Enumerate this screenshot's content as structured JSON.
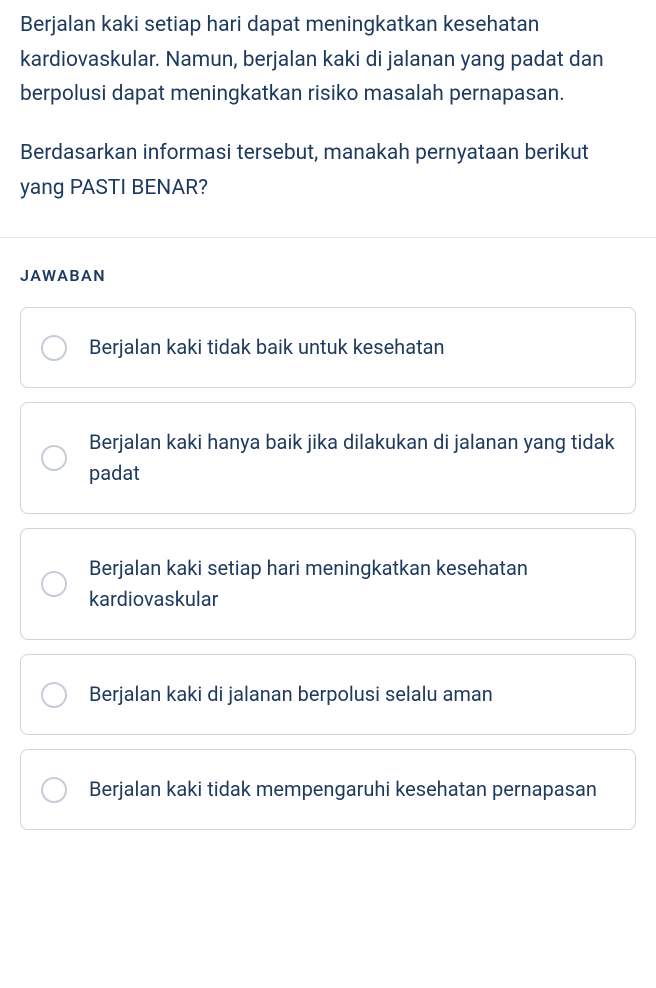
{
  "question": {
    "paragraph1": "Berjalan kaki setiap hari dapat meningkatkan kesehatan kardiovaskular. Namun, berjalan kaki di jalanan yang padat dan berpolusi dapat meningkatkan risiko masalah pernapasan.",
    "paragraph2": "Berdasarkan informasi tersebut, manakah pernyataan berikut yang PASTI BENAR?"
  },
  "answerHeading": "JAWABAN",
  "answers": [
    {
      "label": "Berjalan kaki tidak baik untuk kesehatan"
    },
    {
      "label": "Berjalan kaki hanya baik jika dilakukan di jalanan yang tidak padat"
    },
    {
      "label": "Berjalan kaki setiap hari meningkatkan kesehatan kardiovaskular"
    },
    {
      "label": "Berjalan kaki di jalanan berpolusi selalu aman"
    },
    {
      "label": "Berjalan kaki tidak mempengaruhi kesehatan pernapasan"
    }
  ]
}
